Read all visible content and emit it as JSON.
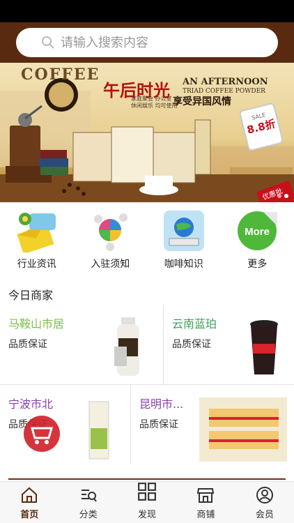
{
  "search": {
    "placeholder": "请输入搜索内容"
  },
  "banner": {
    "coffee_word": "COFFEE",
    "title_cn": "午后时光",
    "title_en_1": "AN AFTERNOON",
    "title_en_2": "TRIAD COFFEE POWDER",
    "sub_1": "家庭聚会 办公室",
    "sub_2": "休闲娱乐 均可使用",
    "slogan": "享受异国风情",
    "sale_label": "SALE",
    "sale_value": "8.8折",
    "promo": "优惠批发"
  },
  "quick_nav": [
    {
      "label": "行业资讯",
      "icon": "mail-flower-icon"
    },
    {
      "label": "入驻须知",
      "icon": "people-puzzle-icon"
    },
    {
      "label": "咖啡知识",
      "icon": "globe-book-icon"
    },
    {
      "label": "更多",
      "icon": "more-badge-icon",
      "badge": "More"
    }
  ],
  "section_title": "今日商家",
  "merchants": [
    {
      "name": "马鞍山市居",
      "desc": "品质保证",
      "color": "#7fbf3f"
    },
    {
      "name": "云南蓝珀",
      "desc": "品质保证",
      "color": "#3aa05a"
    },
    {
      "name": "宁波市北",
      "desc": "品质保证",
      "color": "#8a3ea8"
    },
    {
      "name": "昆明市...",
      "desc": "品质保证",
      "color": "#8a3ea8"
    }
  ],
  "tabs": [
    {
      "label": "首页",
      "icon": "home-icon",
      "active": true
    },
    {
      "label": "分类",
      "icon": "category-search-icon",
      "active": false
    },
    {
      "label": "发现",
      "icon": "grid-icon",
      "active": false
    },
    {
      "label": "商铺",
      "icon": "shop-icon",
      "active": false
    },
    {
      "label": "会员",
      "icon": "user-icon",
      "active": false
    }
  ],
  "colors": {
    "brand": "#5a2a10",
    "accent_red": "#c8101a"
  }
}
